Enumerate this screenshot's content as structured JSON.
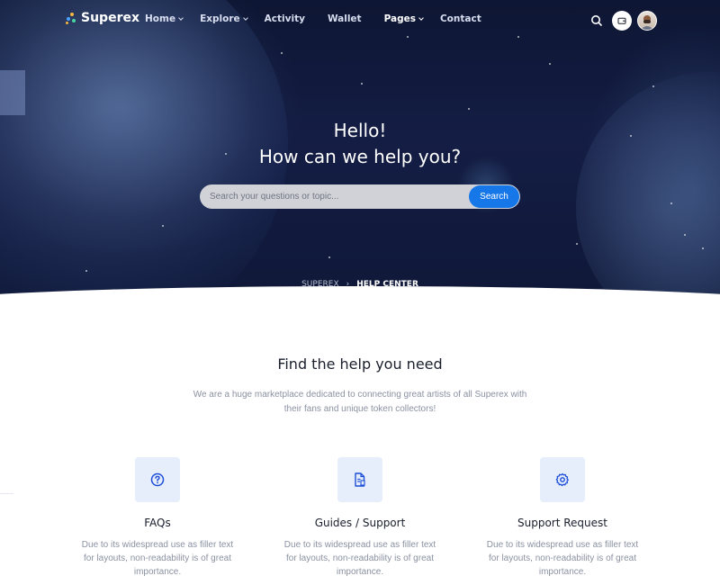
{
  "brand": {
    "name": "Superex"
  },
  "nav": {
    "items": [
      {
        "label": "Home",
        "dropdown": true
      },
      {
        "label": "Explore",
        "dropdown": true
      },
      {
        "label": "Activity",
        "dropdown": false
      },
      {
        "label": "Wallet",
        "dropdown": false
      },
      {
        "label": "Pages",
        "dropdown": true,
        "active": true
      },
      {
        "label": "Contact",
        "dropdown": false
      }
    ],
    "icons": [
      "search-icon",
      "wallet-icon",
      "avatar"
    ]
  },
  "hero": {
    "line1": "Hello!",
    "line2": "How can we help you?",
    "search_placeholder": "Search your questions or topic...",
    "search_button": "Search",
    "breadcrumb": {
      "home": "SUPEREX",
      "separator": "›",
      "current": "HELP CENTER"
    }
  },
  "help": {
    "title": "Find the help you need",
    "description": "We are a huge marketplace dedicated to connecting great artists of all Superex with their fans and unique token collectors!",
    "cards": [
      {
        "icon": "question-circle-icon",
        "title": "FAQs",
        "text": "Due to its widespread use as filler text for layouts, non-readability is of great importance."
      },
      {
        "icon": "document-icon",
        "title": "Guides / Support",
        "text": "Due to its widespread use as filler text for layouts, non-readability is of great importance."
      },
      {
        "icon": "gear-icon",
        "title": "Support Request",
        "text": "Due to its widespread use as filler text for layouts, non-readability is of great importance."
      }
    ]
  },
  "colors": {
    "accent": "#1677e8",
    "hero_bg": "#141d44",
    "icon_bg": "#e6eefb",
    "heading": "#1a1f2c",
    "body_text": "#8a91a1"
  }
}
